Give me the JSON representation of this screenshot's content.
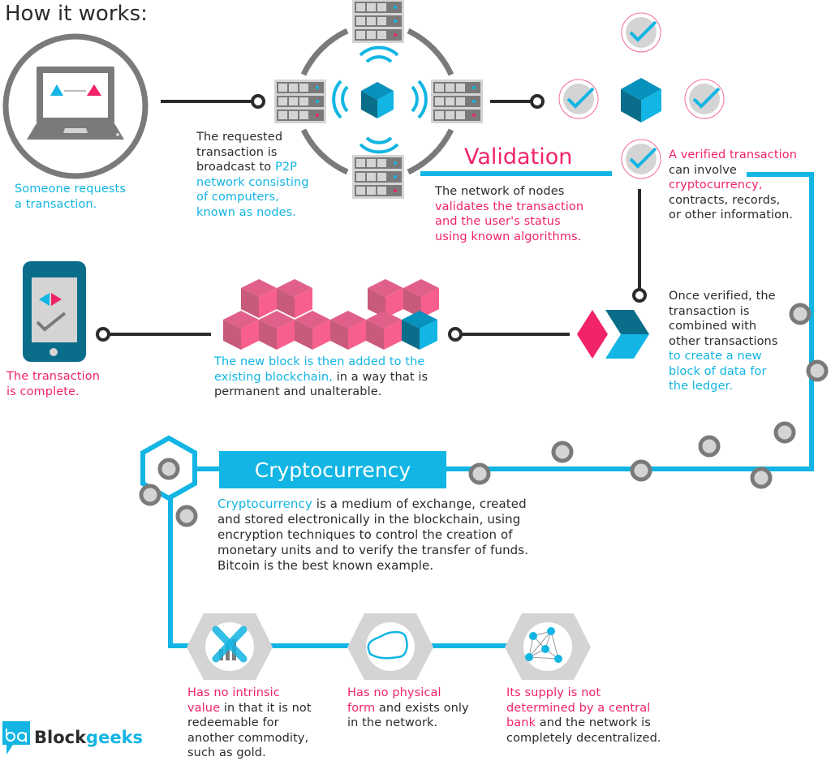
{
  "title": "How it works:",
  "steps": {
    "request": {
      "text": "Someone requests a transaction.",
      "lines": [
        "Someone requests",
        "a transaction."
      ]
    },
    "broadcast": {
      "lines": [
        [
          {
            "t": "The requested",
            "c": "dark"
          }
        ],
        [
          {
            "t": "transaction is",
            "c": "dark"
          }
        ],
        [
          {
            "t": "broadcast to ",
            "c": "dark"
          },
          {
            "t": "P2P",
            "c": "cyan"
          }
        ],
        [
          {
            "t": "network consisting",
            "c": "cyan"
          }
        ],
        [
          {
            "t": "of computers,",
            "c": "cyan"
          }
        ],
        [
          {
            "t": "known as nodes.",
            "c": "cyan"
          }
        ]
      ]
    },
    "validation": {
      "title": "Validation",
      "lines": [
        [
          {
            "t": "The network of nodes",
            "c": "dark"
          }
        ],
        [
          {
            "t": "validates the transaction",
            "c": "pink"
          }
        ],
        [
          {
            "t": "and the user's status",
            "c": "pink"
          }
        ],
        [
          {
            "t": "using known algorithms.",
            "c": "pink"
          }
        ]
      ]
    },
    "verified": {
      "lines": [
        [
          {
            "t": "A verified transaction",
            "c": "pink"
          }
        ],
        [
          {
            "t": "can involve",
            "c": "dark"
          }
        ],
        [
          {
            "t": "cryptocurrency,",
            "c": "pink"
          }
        ],
        [
          {
            "t": "contracts, records,",
            "c": "dark"
          }
        ],
        [
          {
            "t": "or other information.",
            "c": "dark"
          }
        ]
      ]
    },
    "combined": {
      "lines": [
        [
          {
            "t": "Once verified, the",
            "c": "dark"
          }
        ],
        [
          {
            "t": "transaction is",
            "c": "dark"
          }
        ],
        [
          {
            "t": "combined with",
            "c": "dark"
          }
        ],
        [
          {
            "t": "other transactions",
            "c": "dark"
          }
        ],
        [
          {
            "t": "to create a new",
            "c": "cyan"
          }
        ],
        [
          {
            "t": "block of data for",
            "c": "cyan"
          }
        ],
        [
          {
            "t": "the ledger.",
            "c": "cyan"
          }
        ]
      ]
    },
    "added": {
      "lines": [
        [
          {
            "t": "The new block is then added to the",
            "c": "cyan"
          }
        ],
        [
          {
            "t": "existing blockchain,",
            "c": "cyan"
          },
          {
            "t": " in a way that is",
            "c": "dark"
          }
        ],
        [
          {
            "t": "permanent and unalterable.",
            "c": "dark"
          }
        ]
      ]
    },
    "complete": {
      "lines": [
        [
          {
            "t": "The transaction",
            "c": "pink"
          }
        ],
        [
          {
            "t": "is complete.",
            "c": "pink"
          }
        ]
      ]
    }
  },
  "cryptocurrency": {
    "label": "Cryptocurrency",
    "lines": [
      [
        {
          "t": "Cryptocurrency",
          "c": "cyan"
        },
        {
          "t": " is a medium of exchange, created",
          "c": "dark"
        }
      ],
      [
        {
          "t": "and stored electronically in the blockchain, using",
          "c": "dark"
        }
      ],
      [
        {
          "t": "encryption techniques to control the creation of",
          "c": "dark"
        }
      ],
      [
        {
          "t": "monetary units and to verify the transfer of funds.",
          "c": "dark"
        }
      ],
      [
        {
          "t": "Bitcoin is the best known example.",
          "c": "dark"
        }
      ]
    ],
    "properties": [
      {
        "icon": "no-value-chart-icon",
        "lines": [
          [
            {
              "t": "Has no intrinsic",
              "c": "pink"
            }
          ],
          [
            {
              "t": "value",
              "c": "pink"
            },
            {
              "t": " in that it is not",
              "c": "dark"
            }
          ],
          [
            {
              "t": "redeemable for",
              "c": "dark"
            }
          ],
          [
            {
              "t": "another commodity,",
              "c": "dark"
            }
          ],
          [
            {
              "t": "such as gold.",
              "c": "dark"
            }
          ]
        ]
      },
      {
        "icon": "amorphous-shape-icon",
        "lines": [
          [
            {
              "t": "Has no physical",
              "c": "pink"
            }
          ],
          [
            {
              "t": "form",
              "c": "pink"
            },
            {
              "t": " and exists only",
              "c": "dark"
            }
          ],
          [
            {
              "t": "in the network.",
              "c": "dark"
            }
          ]
        ]
      },
      {
        "icon": "network-graph-icon",
        "lines": [
          [
            {
              "t": "Its supply is not",
              "c": "pink"
            }
          ],
          [
            {
              "t": "determined by a central",
              "c": "pink"
            }
          ],
          [
            {
              "t": "bank",
              "c": "pink"
            },
            {
              "t": " and the network is",
              "c": "dark"
            }
          ],
          [
            {
              "t": "completely decentralized.",
              "c": "dark"
            }
          ]
        ]
      }
    ]
  },
  "logo": {
    "part1": "Block",
    "part2": "geeks",
    "mark": "bg"
  },
  "colors": {
    "pink": "#f02466",
    "cyan": "#12b5e3",
    "dark_teal": "#0a6d8a",
    "gray": "#7a7a7a",
    "light_gray": "#d4d4d4",
    "block_pink": "#f75f8c",
    "text": "#2b2b2b"
  }
}
